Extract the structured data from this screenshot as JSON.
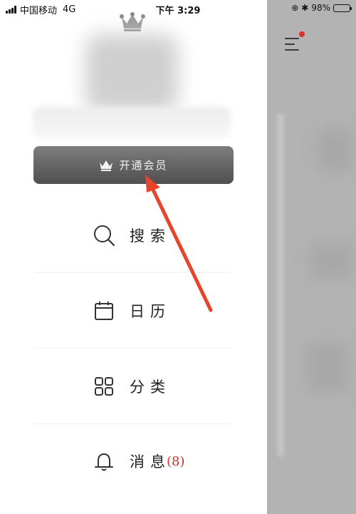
{
  "status_bar": {
    "carrier": "中国移动",
    "network": "4G",
    "time": "下午 3:29",
    "battery_text": "98%",
    "battery_level": 0.98,
    "icons": [
      "signal-icon",
      "orientation-lock-icon",
      "bluetooth-icon",
      "battery-icon"
    ]
  },
  "drawer": {
    "vip_button": {
      "label": "开通会员",
      "icon": "crown-icon"
    },
    "menu": [
      {
        "label": "搜索",
        "icon": "search-icon"
      },
      {
        "label": "日历",
        "icon": "calendar-icon"
      },
      {
        "label": "分类",
        "icon": "category-grid-icon"
      },
      {
        "label": "消息",
        "icon": "bell-icon",
        "badge": "(8)"
      }
    ]
  },
  "colors": {
    "accent_red": "#d9322b",
    "arrow_red": "#e8442b",
    "vip_button_top": "#7e7e7e",
    "vip_button_bottom": "#4f4f4f",
    "overlay_gray": "#b3b3b3"
  }
}
